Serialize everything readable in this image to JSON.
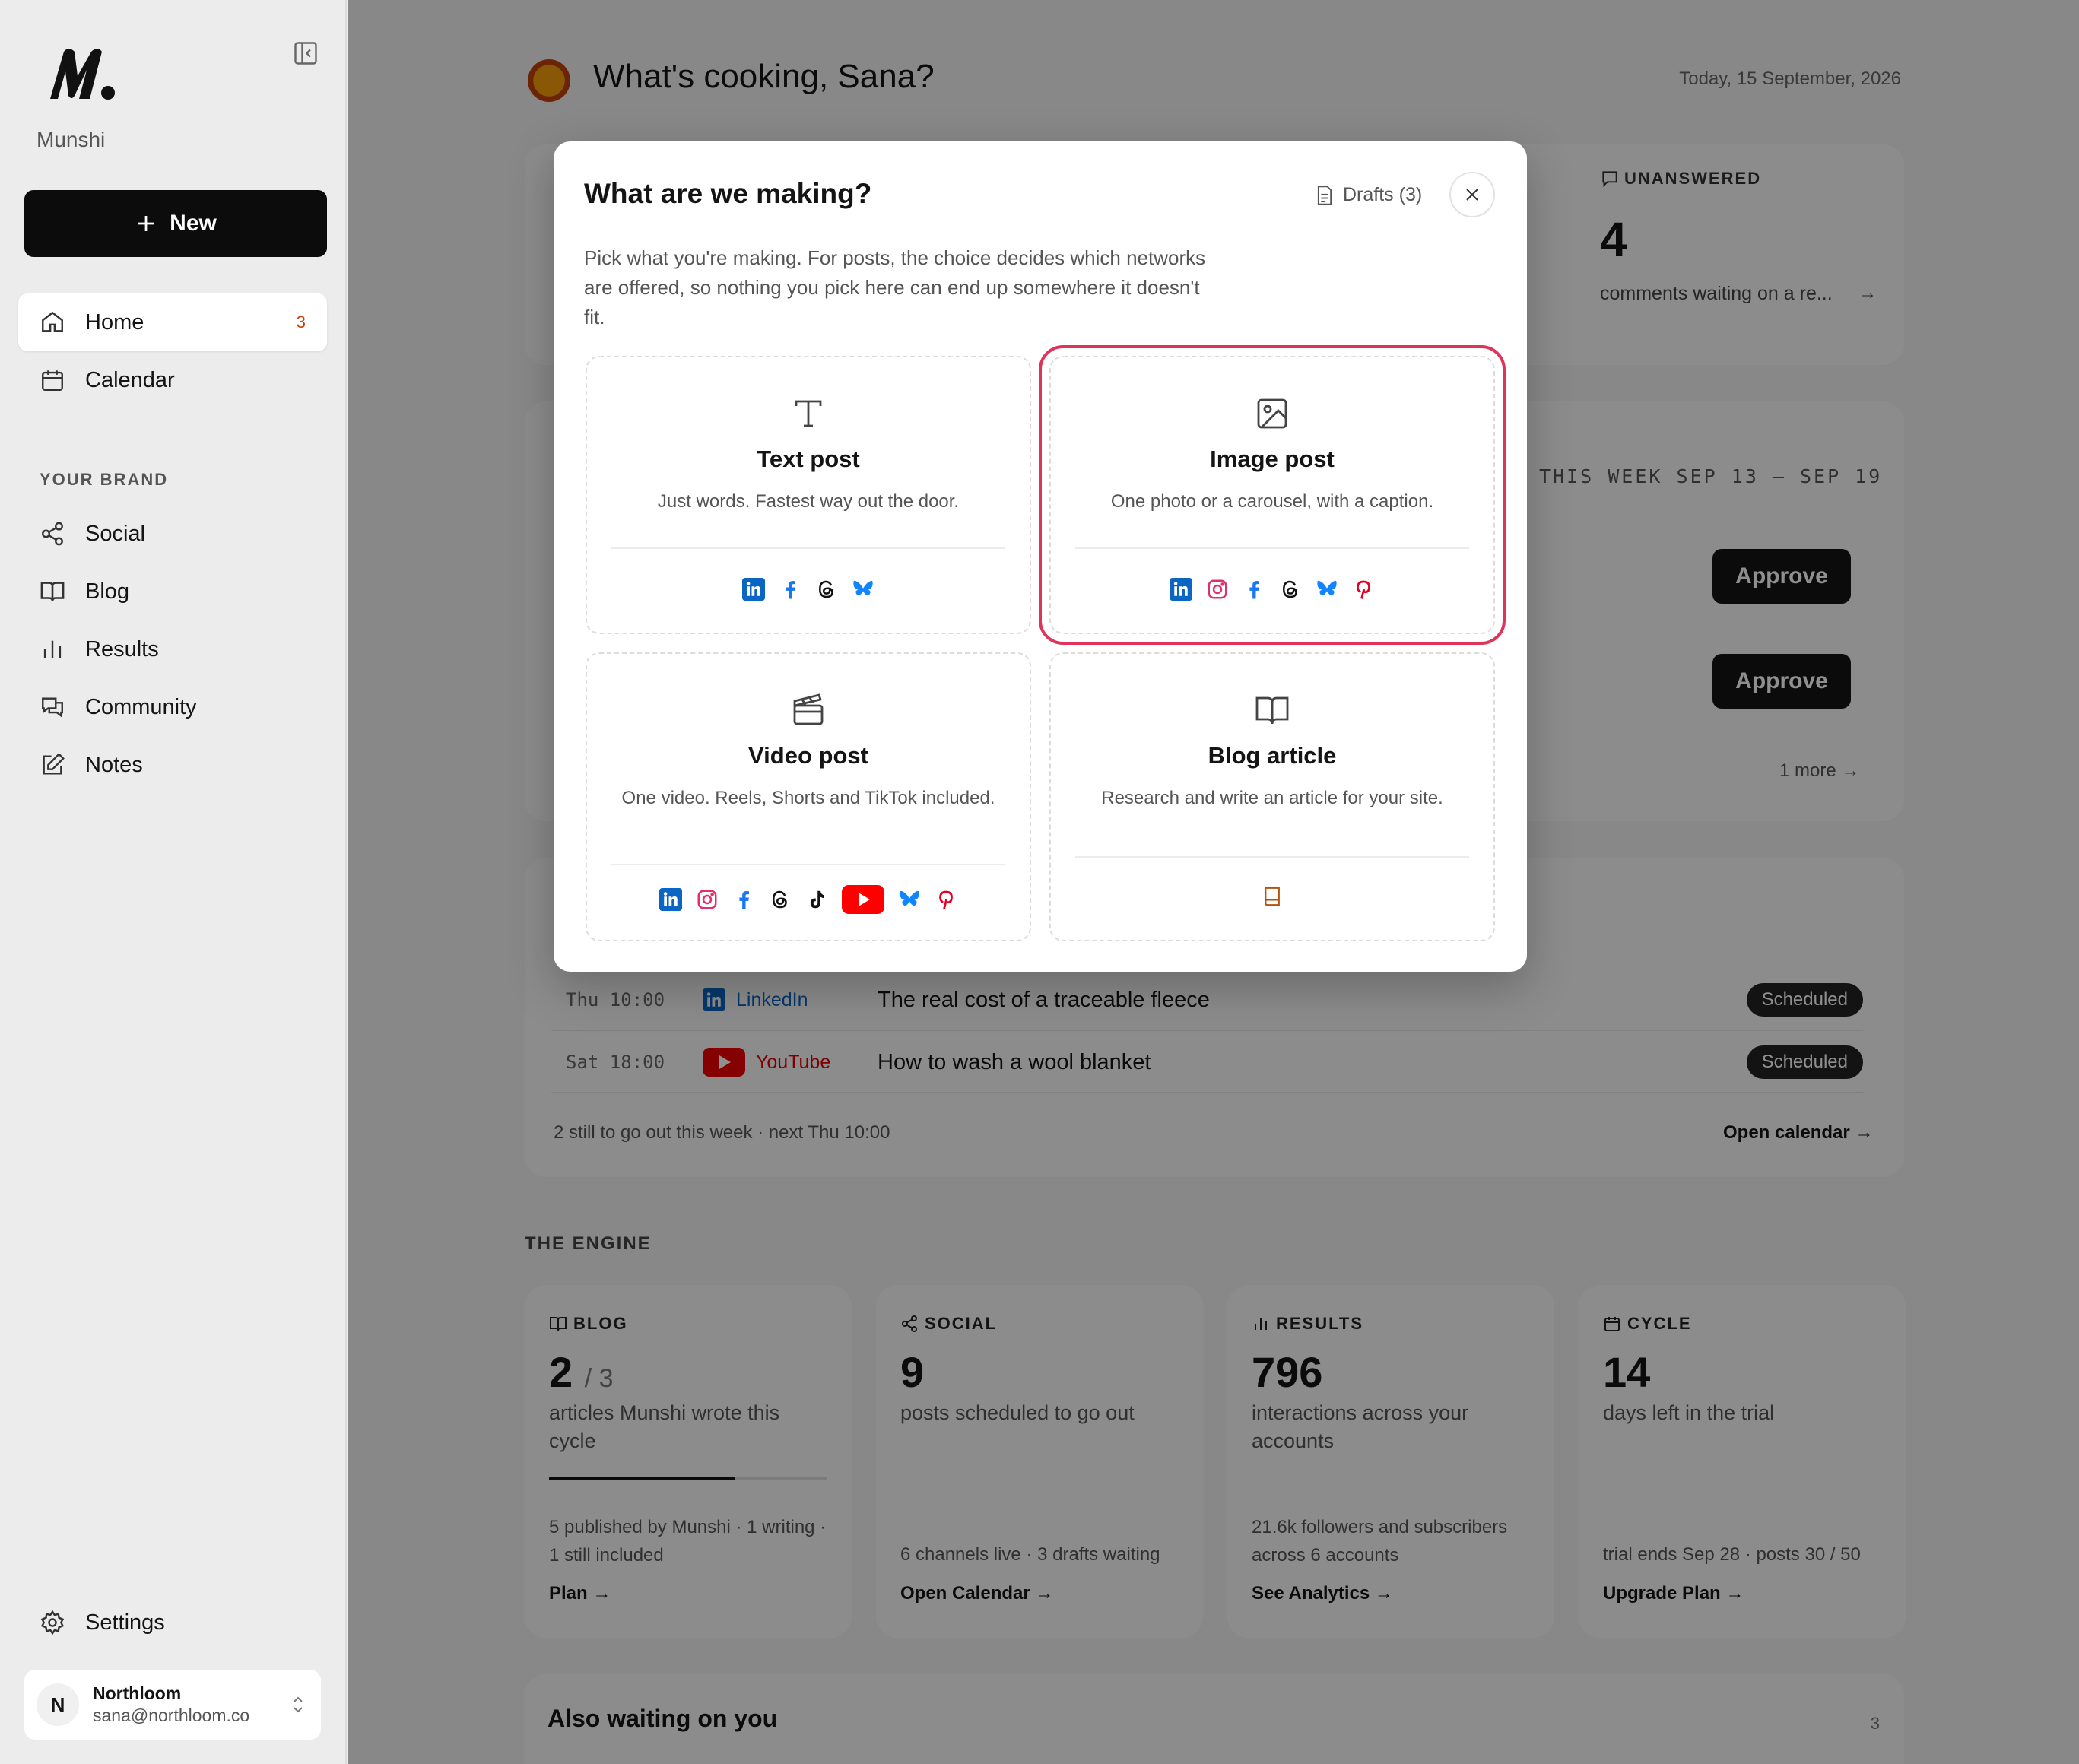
{
  "sidebar": {
    "brand": "Munshi",
    "new_label": "New",
    "nav": [
      {
        "label": "Home",
        "badge": "3"
      },
      {
        "label": "Calendar"
      }
    ],
    "section_label": "YOUR BRAND",
    "brand_nav": [
      {
        "label": "Social"
      },
      {
        "label": "Blog"
      },
      {
        "label": "Results"
      },
      {
        "label": "Community"
      },
      {
        "label": "Notes"
      }
    ],
    "settings_label": "Settings",
    "account": {
      "initial": "N",
      "name": "Northloom",
      "email": "sana@northloom.co"
    }
  },
  "main": {
    "greeting": "What's cooking, Sana?",
    "date": "Today, 15 September, 2026",
    "unanswered": {
      "label": "UNANSWERED",
      "count": "4",
      "sub": "comments waiting on a re...",
      "arrow": "→"
    },
    "week_label": "THIS WEEK   SEP 13 – SEP 19",
    "approve_label": "Approve",
    "one_more": "1 more →",
    "schedule": [
      {
        "time": "Thu 10:00",
        "network": "LinkedIn",
        "title": "The real cost of a traceable fleece",
        "status": "Scheduled"
      },
      {
        "time": "Sat 18:00",
        "network": "YouTube",
        "title": "How to wash a wool blanket",
        "status": "Scheduled"
      }
    ],
    "schedule_footer": "2 still to go out this week · next Thu 10:00",
    "schedule_link": "Open calendar →",
    "engine_label": "THE ENGINE",
    "engine": [
      {
        "label": "BLOG",
        "num": "2",
        "den": "/ 3",
        "desc": "articles Munshi wrote this cycle",
        "foot": "5 published by Munshi · 1 writing · 1 still included",
        "link": "Plan →",
        "progress": 0.67
      },
      {
        "label": "SOCIAL",
        "num": "9",
        "desc": "posts scheduled to go out",
        "foot": "6 channels live · 3 drafts waiting",
        "link": "Open Calendar →"
      },
      {
        "label": "RESULTS",
        "num": "796",
        "desc": "interactions across your accounts",
        "foot": "21.6k followers and subscribers across 6 accounts",
        "link": "See Analytics →"
      },
      {
        "label": "CYCLE",
        "num": "14",
        "desc": "days left in the trial",
        "foot": "trial ends Sep 28 · posts 30 / 50",
        "link": "Upgrade Plan →"
      }
    ],
    "also_title": "Also waiting on you",
    "also_count": "3"
  },
  "modal": {
    "title": "What are we making?",
    "drafts_label": "Drafts (3)",
    "description": "Pick what you're making. For posts, the choice decides which networks are offered, so nothing you pick here can end up somewhere it doesn't fit.",
    "options": [
      {
        "title": "Text post",
        "sub": "Just words. Fastest way out the door.",
        "icon": "text-icon",
        "networks": [
          "linkedin",
          "facebook",
          "threads",
          "bluesky"
        ]
      },
      {
        "title": "Image post",
        "sub": "One photo or a carousel, with a caption.",
        "icon": "image-icon",
        "networks": [
          "linkedin",
          "instagram",
          "facebook",
          "threads",
          "bluesky",
          "pinterest"
        ],
        "highlighted": true
      },
      {
        "title": "Video post",
        "sub": "One video. Reels, Shorts and TikTok included.",
        "icon": "clapperboard-icon",
        "networks": [
          "linkedin",
          "instagram",
          "facebook",
          "threads",
          "tiktok",
          "youtube",
          "bluesky",
          "pinterest"
        ]
      },
      {
        "title": "Blog article",
        "sub": "Research and write an article for your site.",
        "icon": "book-icon",
        "networks": [
          "blog-book"
        ]
      }
    ]
  },
  "colors": {
    "accent_highlight": "#e0335a",
    "linkedin": "#0a66c2",
    "youtube": "#ff0000",
    "instagram": "#e1306c",
    "pinterest": "#e60023",
    "bluesky": "#1185fe",
    "facebook": "#1877f2"
  }
}
